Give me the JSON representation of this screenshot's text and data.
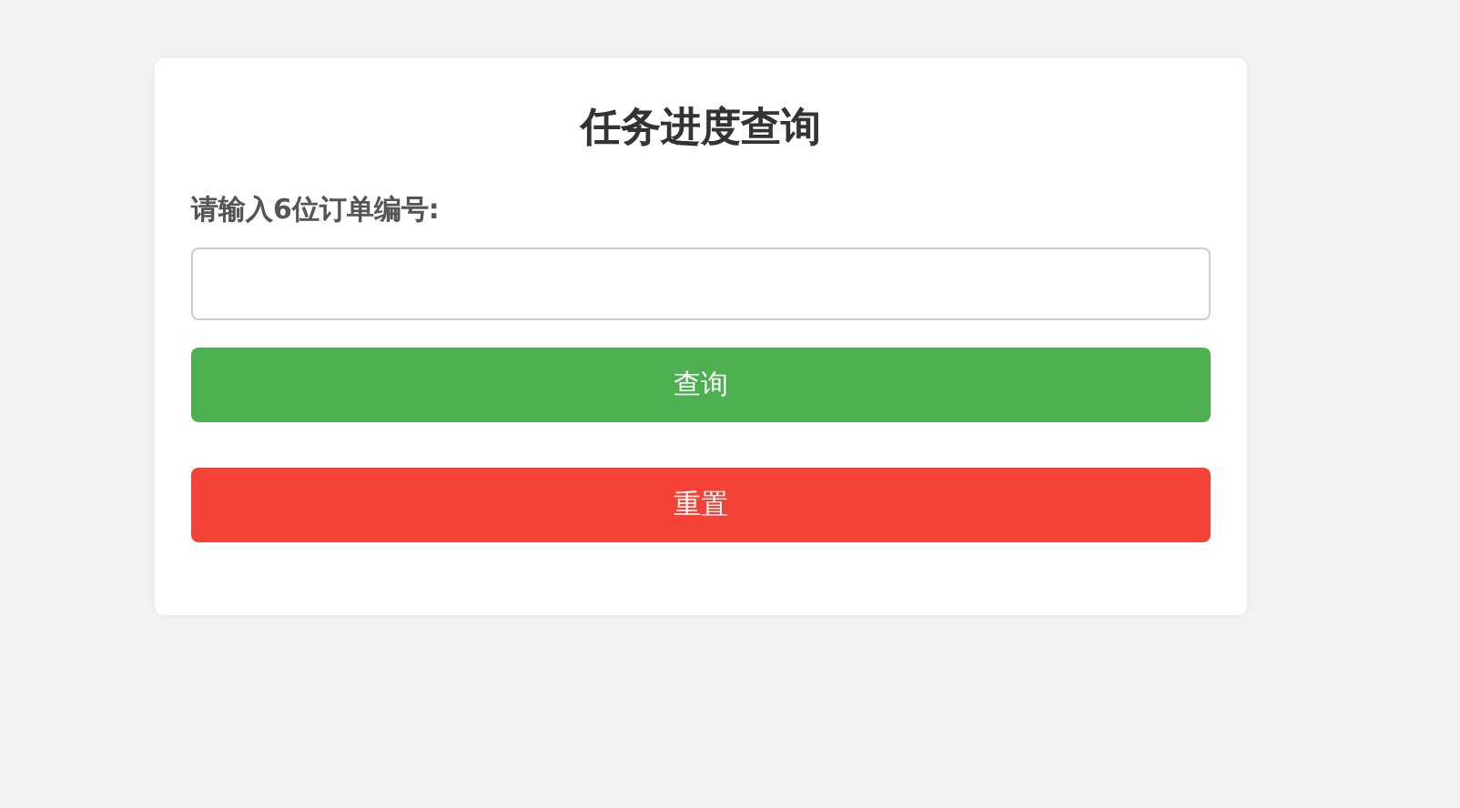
{
  "title": "任务进度查询",
  "form": {
    "label": "请输入6位订单编号:"
  },
  "buttons": [
    {
      "label": "查询",
      "kind": "submit"
    },
    {
      "label": "重置",
      "kind": "reset"
    }
  ]
}
